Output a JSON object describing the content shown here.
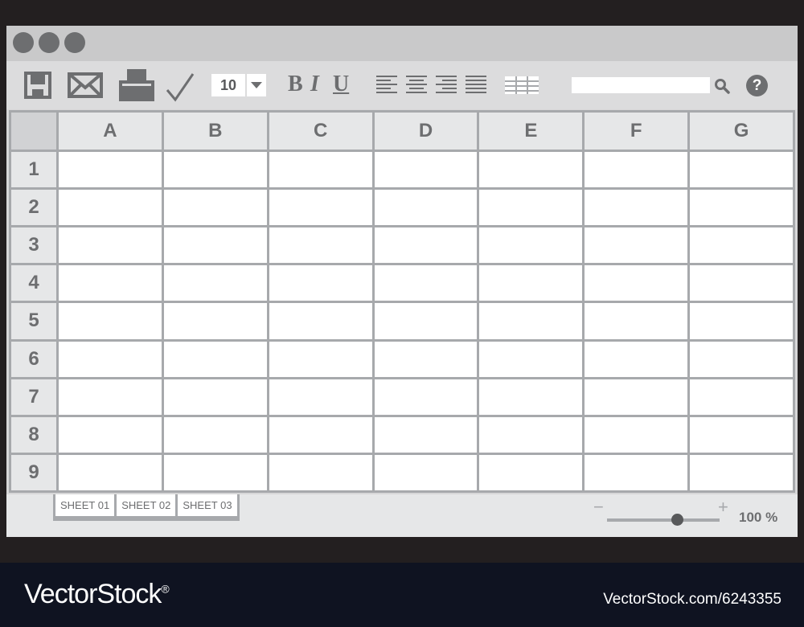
{
  "window": {
    "controls": [
      "window-dot-1",
      "window-dot-2",
      "window-dot-3"
    ]
  },
  "toolbar": {
    "font_size": "10",
    "bold_label": "B",
    "italic_label": "I",
    "underline_label": "U",
    "help_label": "?",
    "search_placeholder": "",
    "icons": [
      "save-icon",
      "mail-icon",
      "print-icon",
      "check-icon",
      "align-left-icon",
      "align-center-icon",
      "align-right-icon",
      "align-justify-icon",
      "table-icon",
      "search-icon",
      "help-icon"
    ]
  },
  "grid": {
    "columns": [
      "A",
      "B",
      "C",
      "D",
      "E",
      "F",
      "G"
    ],
    "rows": [
      "1",
      "2",
      "3",
      "4",
      "5",
      "6",
      "7",
      "8",
      "9"
    ]
  },
  "footer": {
    "sheets": [
      "SHEET 01",
      "SHEET 02",
      "SHEET 03"
    ],
    "zoom_minus": "−",
    "zoom_plus": "+",
    "zoom_label": "100 %",
    "zoom_level": 0.62
  },
  "banner": {
    "brand": "VectorStock",
    "brand_mark": "®",
    "image_id": "VectorStock.com/6243355"
  },
  "colors": {
    "background": "#231f20",
    "window": "#d7d7d8",
    "header": "#e6e7e8",
    "gridline": "#a7a9ac",
    "text": "#6d6e70",
    "banner": "#0f1321"
  }
}
